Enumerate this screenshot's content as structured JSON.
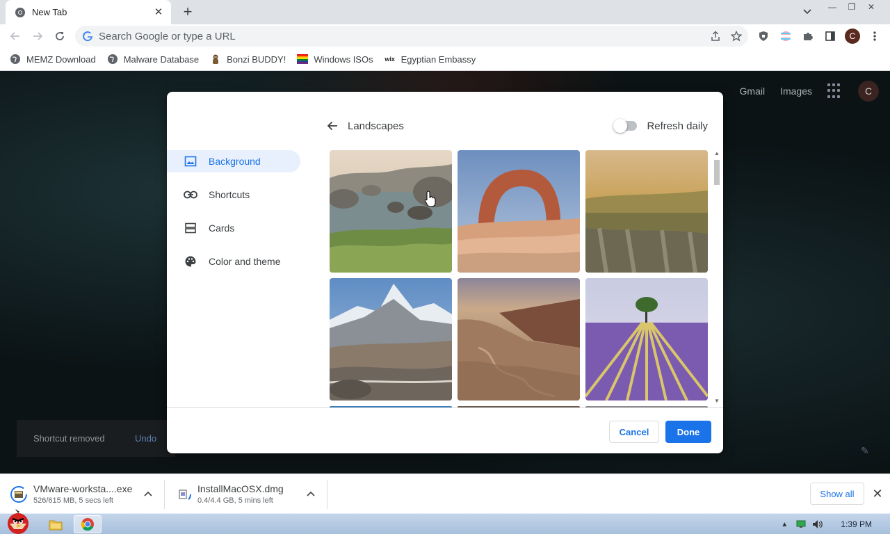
{
  "browser": {
    "tab_title": "New Tab",
    "omnibox_placeholder": "Search Google or type a URL",
    "profile_initial": "C"
  },
  "bookmarks": [
    {
      "label": "MEMZ Download",
      "icon": "globe-icon"
    },
    {
      "label": "Malware Database",
      "icon": "globe-icon"
    },
    {
      "label": "Bonzi BUDDY!",
      "icon": "bonzi-icon"
    },
    {
      "label": "Windows ISOs",
      "icon": "rainbow-flag-icon"
    },
    {
      "label": "Egyptian Embassy",
      "icon": "wix-icon"
    }
  ],
  "ntp": {
    "gmail": "Gmail",
    "images": "Images",
    "avatar_initial": "C",
    "toast_message": "Shortcut removed",
    "toast_undo": "Undo"
  },
  "dialog": {
    "sidebar": [
      {
        "label": "Background",
        "icon": "image-icon",
        "active": true
      },
      {
        "label": "Shortcuts",
        "icon": "link-icon",
        "active": false
      },
      {
        "label": "Cards",
        "icon": "cards-icon",
        "active": false
      },
      {
        "label": "Color and theme",
        "icon": "palette-icon",
        "active": false
      }
    ],
    "header_title": "Landscapes",
    "refresh_label": "Refresh daily",
    "refresh_on": false,
    "cancel_label": "Cancel",
    "done_label": "Done",
    "tiles": [
      "rocky-lake",
      "delicate-arch",
      "canyon-sunset",
      "snowy-mountain",
      "desert-canyon",
      "lavender-field"
    ]
  },
  "downloads": [
    {
      "name": "VMware-worksta....exe",
      "status": "526/615 MB, 5 secs left"
    },
    {
      "name": "InstallMacOSX.dmg",
      "status": "0.4/4.4 GB, 5 mins left"
    }
  ],
  "show_all_label": "Show all",
  "taskbar": {
    "clock": "1:39 PM"
  },
  "colors": {
    "accent": "#1a73e8",
    "sidebar_active_bg": "#e8f0fe"
  }
}
